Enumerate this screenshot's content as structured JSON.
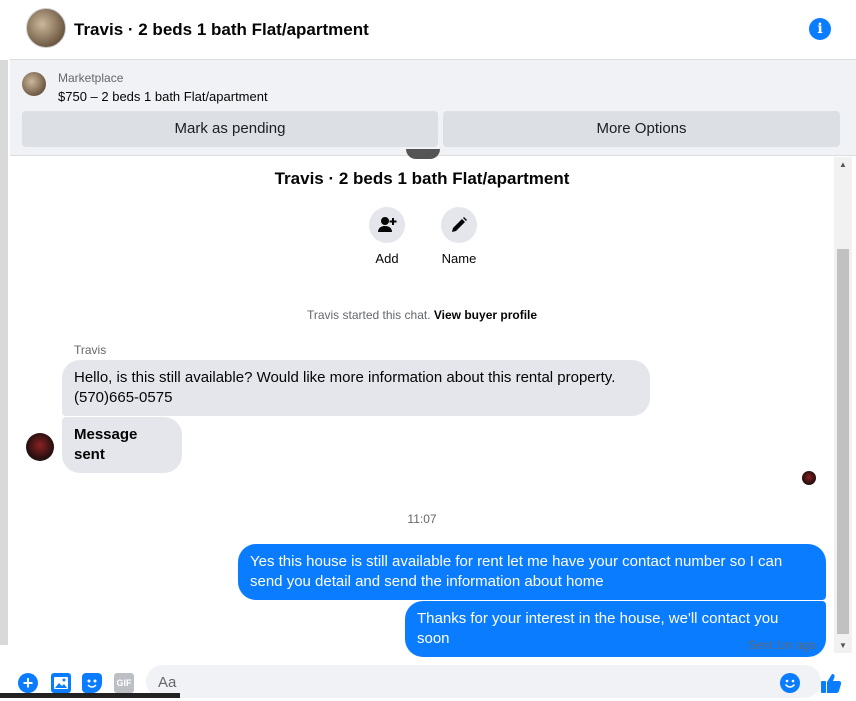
{
  "header": {
    "title": "Travis · 2 beds 1 bath Flat/apartment",
    "info_icon": "info-icon"
  },
  "banner": {
    "source": "Marketplace",
    "listing": "$750 – 2 beds 1 bath Flat/apartment",
    "mark_pending": "Mark as pending",
    "more_options": "More Options"
  },
  "thread": {
    "title": "Travis · 2 beds 1 bath Flat/apartment",
    "actions": [
      {
        "label": "Add",
        "icon": "add-person-icon"
      },
      {
        "label": "Name",
        "icon": "pencil-icon"
      }
    ],
    "started_text": "Travis started this chat.",
    "view_profile": "View buyer profile",
    "sender_name": "Travis",
    "incoming": [
      "Hello, is this still available? Would like more information about this rental property. (570)665-0575",
      "Message sent"
    ],
    "time": "11:07",
    "outgoing": [
      "Yes this house is still available for rent let me have your contact number so I can send you detail and send the information about home",
      "Thanks for your interest in the house, we'll contact you soon"
    ],
    "status": "Sent 1m ago"
  },
  "composer": {
    "placeholder": "Aa",
    "gif_label": "GIF"
  },
  "colors": {
    "accent": "#0a7cff",
    "bubble_in": "#e4e6eb",
    "banner_bg": "#f0f2f5"
  }
}
